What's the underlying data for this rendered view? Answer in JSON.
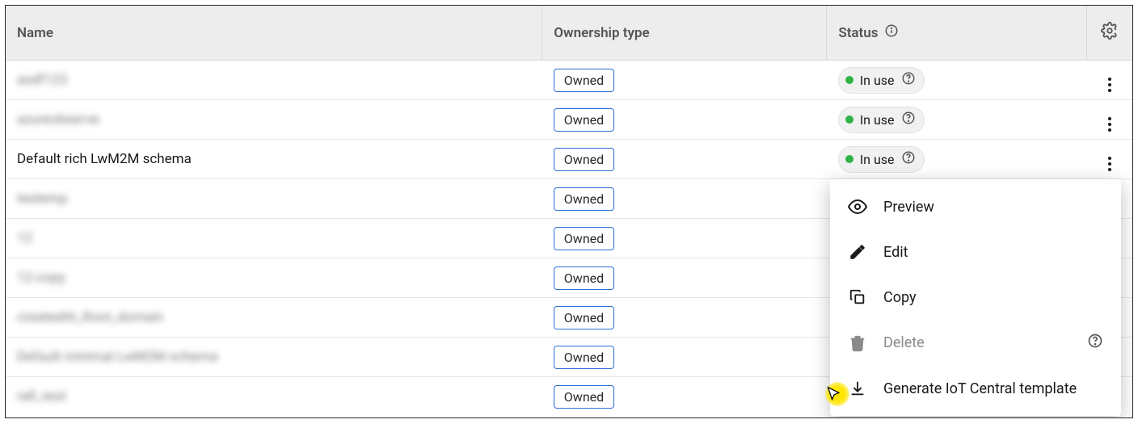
{
  "columns": {
    "name": "Name",
    "ownership": "Ownership type",
    "status": "Status"
  },
  "ownership_label": "Owned",
  "status": {
    "label": "In use"
  },
  "rows": [
    {
      "name": "asdf123",
      "blurred": true,
      "status_visible": true,
      "kebab": true
    },
    {
      "name": "azureobserve",
      "blurred": true,
      "status_visible": true,
      "kebab": true
    },
    {
      "name": "Default rich LwM2M schema",
      "blurred": false,
      "status_visible": true,
      "kebab": true
    },
    {
      "name": "testemp",
      "blurred": true,
      "status_visible": false,
      "kebab": false
    },
    {
      "name": "12",
      "blurred": true,
      "status_visible": false,
      "kebab": false
    },
    {
      "name": "12-copy",
      "blurred": true,
      "status_visible": false,
      "kebab": false
    },
    {
      "name": "createdAt_Root_domain",
      "blurred": true,
      "status_visible": false,
      "kebab": false
    },
    {
      "name": "Default minimal LwM2M schema",
      "blurred": true,
      "status_visible": false,
      "kebab": false
    },
    {
      "name": "rafi_test",
      "blurred": true,
      "status_visible": false,
      "kebab": false
    }
  ],
  "menu": {
    "preview": "Preview",
    "edit": "Edit",
    "copy": "Copy",
    "delete": "Delete",
    "generate": "Generate IoT Central template"
  }
}
